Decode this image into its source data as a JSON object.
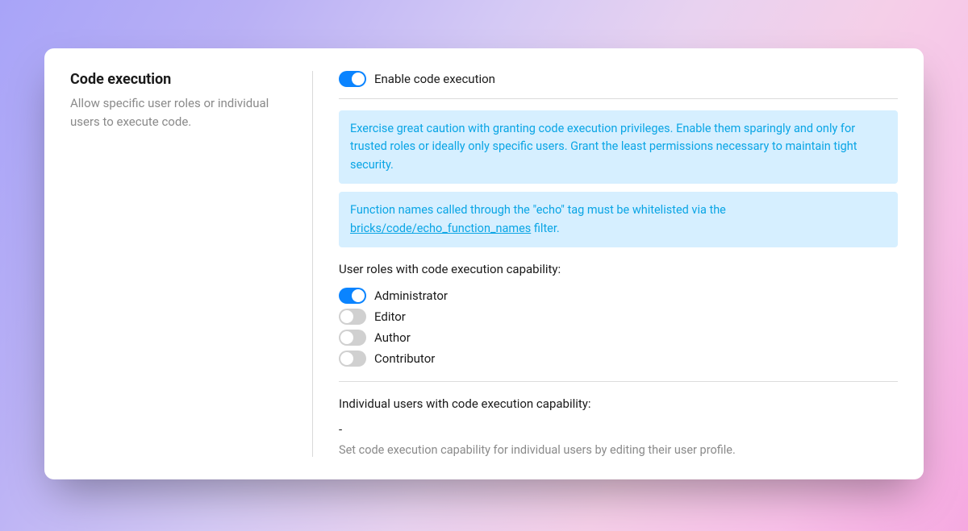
{
  "section": {
    "title": "Code execution",
    "description": "Allow specific user roles or individual users to execute code."
  },
  "main": {
    "enable_toggle": {
      "label": "Enable code execution",
      "on": true
    },
    "notices": {
      "caution": "Exercise great caution with granting code execution privileges. Enable them sparingly and only for trusted roles or ideally only specific users. Grant the least permissions necessary to maintain tight security.",
      "whitelist_prefix": "Function names called through the \"echo\" tag must be whitelisted via the ",
      "whitelist_link": "bricks/code/echo_function_names",
      "whitelist_suffix": " filter."
    },
    "roles_heading": "User roles with code execution capability:",
    "roles": [
      {
        "label": "Administrator",
        "on": true
      },
      {
        "label": "Editor",
        "on": false
      },
      {
        "label": "Author",
        "on": false
      },
      {
        "label": "Contributor",
        "on": false
      }
    ],
    "users_heading": "Individual users with code execution capability:",
    "users_empty": "-",
    "users_hint": "Set code execution capability for individual users by editing their user profile."
  }
}
